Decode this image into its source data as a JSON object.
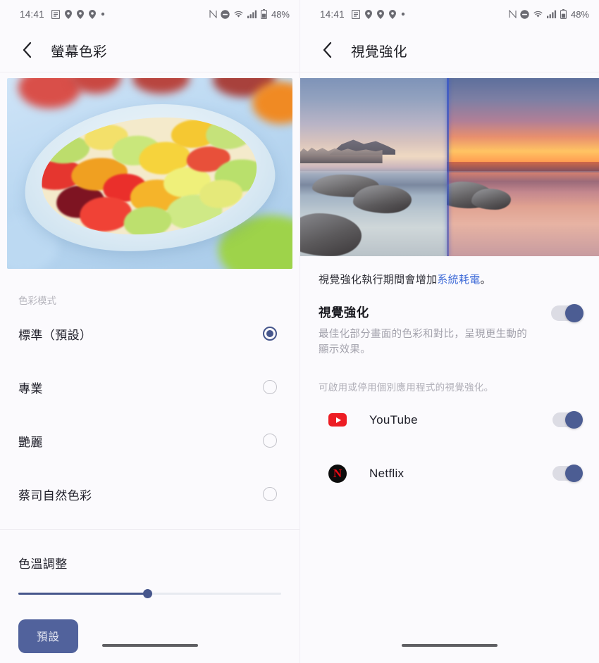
{
  "statusbar": {
    "time": "14:41",
    "left_icons": [
      "note-icon",
      "location-pin-icon",
      "location-pin-icon",
      "location-pin-icon",
      "dot-icon"
    ],
    "right_icons": [
      "nfc-icon",
      "do-not-disturb-icon",
      "wifi-icon",
      "cellular-signal-icon",
      "battery-icon"
    ],
    "nfc_label": "N",
    "battery_percent": "48%"
  },
  "left_screen": {
    "title": "螢幕色彩",
    "back_icon": "back-chevron-icon",
    "preview_image_alt": "fruit-salad-bowl-preview",
    "section_label": "色彩模式",
    "options": [
      {
        "label": "標準（預設）",
        "selected": true
      },
      {
        "label": "專業",
        "selected": false
      },
      {
        "label": "艷麗",
        "selected": false
      },
      {
        "label": "蔡司自然色彩",
        "selected": false
      }
    ],
    "temperature": {
      "title": "色溫調整",
      "slider_percent": 49,
      "reset_button": "預設"
    }
  },
  "right_screen": {
    "title": "視覺強化",
    "back_icon": "back-chevron-icon",
    "preview_image_alt": "sunset-seascape-comparison-preview",
    "note_prefix": "視覺強化執行期間會增加",
    "note_link": "系統耗電",
    "note_suffix": "。",
    "main_toggle": {
      "title": "視覺強化",
      "description": "最佳化部分畫面的色彩和對比，呈現更生動的顯示效果。",
      "enabled": true
    },
    "apps_hint": "可啟用或停用個別應用程式的視覺強化。",
    "apps": [
      {
        "name": "YouTube",
        "icon": "youtube-icon",
        "enabled": true
      },
      {
        "name": "Netflix",
        "icon": "netflix-icon",
        "enabled": true
      }
    ]
  },
  "colors": {
    "accent": "#46568c",
    "link": "#3f6bd8",
    "toggle_on_knob": "#4c5d93",
    "toggle_track": "#dcdce4",
    "button_bg": "#51629c",
    "background": "#fbfafd",
    "youtube_red": "#ed1d24",
    "netflix_red": "#e50914"
  }
}
